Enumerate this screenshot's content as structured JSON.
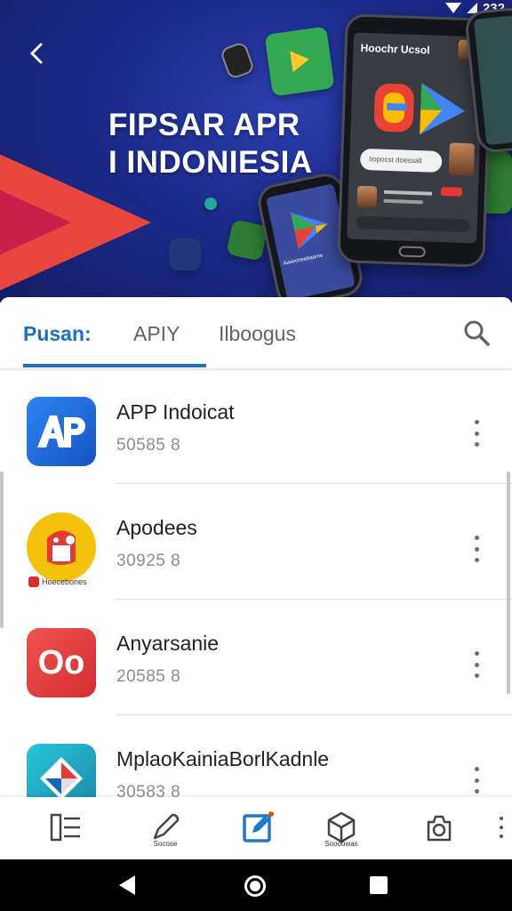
{
  "status_bar": {
    "time": "232"
  },
  "hero": {
    "title_line1": "FIPSAR APR",
    "title_line2": "I INDONIESIA",
    "phone_header": "Hoochr Ucsol",
    "phone_search_placeholder": "Iiopocst doessalt",
    "small_phone_caption": "Aaseonsebaarne"
  },
  "tabs": [
    {
      "label": "Pusan:",
      "active": true
    },
    {
      "label": "APIY",
      "active": false
    },
    {
      "label": "Ilboogus",
      "active": false
    }
  ],
  "apps": [
    {
      "name": "APP Indoicat",
      "meta": "50585 8",
      "icon": "ap-logo-icon",
      "color": "#1e6fe0"
    },
    {
      "name": "Apodees",
      "meta": "30925 8",
      "icon": "red-mascot-icon",
      "color": "#f4c20d",
      "badge": "Hoecebones"
    },
    {
      "name": "Anyarsanie",
      "meta": "20585 8",
      "icon": "do-logo-icon",
      "color": "#e53935",
      "icon_text": "Oo"
    },
    {
      "name": "MplaoKainiaBorlKadnle",
      "meta": "30583 8",
      "icon": "map-star-icon",
      "color": "#2aa6a6"
    }
  ],
  "bottom_nav": [
    {
      "icon": "list-icon",
      "label": ""
    },
    {
      "icon": "pen-icon",
      "label": "Socose"
    },
    {
      "icon": "edit-box-icon",
      "label": "",
      "active": true,
      "accent": "#1f78c8"
    },
    {
      "icon": "cube-icon",
      "label": "Soooowas"
    },
    {
      "icon": "camera-home-icon",
      "label": ""
    }
  ],
  "colors": {
    "accent": "#1f6fbf",
    "hero_bg": "#1c2a8a"
  }
}
